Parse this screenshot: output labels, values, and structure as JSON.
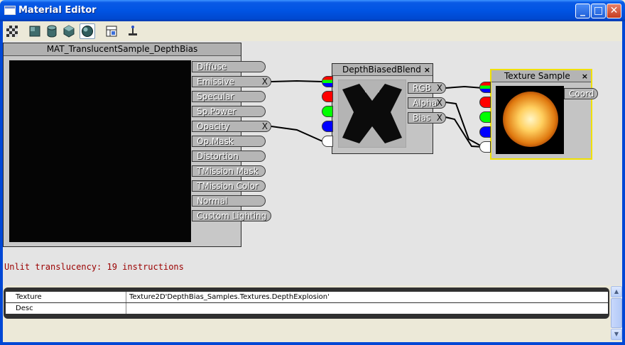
{
  "window": {
    "title": "Material Editor",
    "buttons": {
      "minimize": "_",
      "maximize": "□",
      "close": "✕"
    }
  },
  "toolbar": {
    "tools": [
      {
        "icon": "checker-background-icon"
      },
      {
        "icon": "plane-preview-icon"
      },
      {
        "icon": "cylinder-preview-icon"
      },
      {
        "icon": "cube-preview-icon"
      },
      {
        "icon": "sphere-preview-icon"
      },
      {
        "icon": "toggle-grid-icon"
      },
      {
        "icon": "clean-connectors-icon"
      }
    ]
  },
  "root_node": {
    "title": "MAT_TranslucentSample_DepthBias",
    "inputs": [
      {
        "label": "Diffuse",
        "connected": false
      },
      {
        "label": "Emissive",
        "connected": true
      },
      {
        "label": "Specular",
        "connected": false
      },
      {
        "label": "Sp.Power",
        "connected": false
      },
      {
        "label": "Opacity",
        "connected": true
      },
      {
        "label": "Op.Mask",
        "connected": false
      },
      {
        "label": "Distortion",
        "connected": false
      },
      {
        "label": "TMission Mask",
        "connected": false
      },
      {
        "label": "TMission Color",
        "connected": false
      },
      {
        "label": "Normal",
        "connected": false
      },
      {
        "label": "Custom Lighting",
        "connected": false
      }
    ],
    "disconnect_glyph": "X"
  },
  "dbb_node": {
    "title": "DepthBiasedBlend",
    "close_glyph": "×",
    "outputs": [
      "RGB",
      "Alpha",
      "Bias"
    ],
    "pin_colors": [
      "#ffffff",
      "#ff0000",
      "#00ff00",
      "#0000ff",
      "#ffffff"
    ]
  },
  "tex_node": {
    "title": "Texture Sample",
    "close_glyph": "×",
    "coord_label": "Coord",
    "pin_colors": [
      "#ffffff",
      "#ff0000",
      "#00ff00",
      "#0000ff",
      "#ffffff"
    ]
  },
  "status": "Unlit translucency: 19 instructions",
  "properties": [
    {
      "name": "Texture",
      "value": "Texture2D'DepthBias_Samples.Textures.DepthExplosion'"
    },
    {
      "name": "Desc",
      "value": ""
    }
  ],
  "scrollbar": {
    "up": "▲",
    "down": "▼"
  }
}
